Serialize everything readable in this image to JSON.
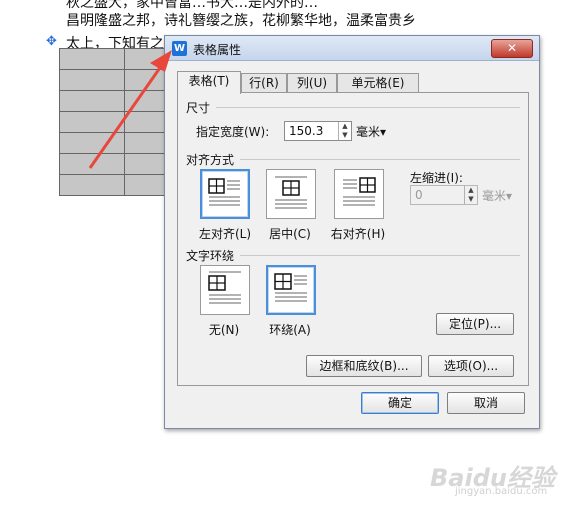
{
  "document": {
    "line0": "秋之盛大，家中曾富…书大…是内外的…",
    "line1": "昌明隆盛之邦，诗礼簪缨之族，花柳繁华地，温柔富贵乡",
    "line2": "太上，下知有之，其次亲而誉之，其次，畏之，其次，侮之"
  },
  "dialog": {
    "title": "表格属性",
    "close_label": "✕",
    "tabs": [
      {
        "label": "表格(T)"
      },
      {
        "label": "行(R)"
      },
      {
        "label": "列(U)"
      },
      {
        "label": "单元格(E)"
      }
    ],
    "size": {
      "section_label": "尺寸",
      "width_label": "指定宽度(W):",
      "width_value": "150.3",
      "unit": "毫米▾"
    },
    "alignment": {
      "section_label": "对齐方式",
      "options": [
        "左对齐(L)",
        "居中(C)",
        "右对齐(H)"
      ],
      "selected": "左对齐(L)",
      "indent_label": "左缩进(I):",
      "indent_value": "0",
      "indent_unit": "毫米▾"
    },
    "wrap": {
      "section_label": "文字环绕",
      "options": [
        "无(N)",
        "环绕(A)"
      ],
      "selected": "环绕(A)",
      "position_button": "定位(P)..."
    },
    "borders_button": "边框和底纹(B)...",
    "options_button": "选项(O)...",
    "ok_button": "确定",
    "cancel_button": "取消"
  },
  "watermark": {
    "text": "Baidu经验",
    "sub": "jingyan.baidu.com"
  },
  "colors": {
    "accent": "#4a8fd8",
    "arrow": "#e8473b",
    "table_fill": "#c6c6c6"
  }
}
